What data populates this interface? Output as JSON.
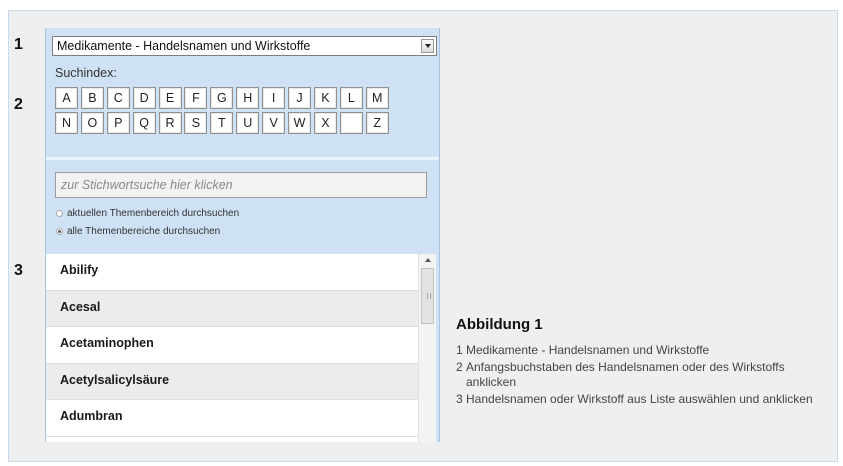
{
  "markers": [
    "1",
    "2",
    "3"
  ],
  "panel": {
    "dropdown": {
      "selected": "Medikamente - Handelsnamen und Wirkstoffe"
    },
    "suchindex_label": "Suchindex:",
    "letters_row1": [
      "A",
      "B",
      "C",
      "D",
      "E",
      "F",
      "G",
      "H",
      "I",
      "J",
      "K",
      "L",
      "M"
    ],
    "letters_row2": [
      "N",
      "O",
      "P",
      "Q",
      "R",
      "S",
      "T",
      "U",
      "V",
      "W",
      "X",
      "",
      "Z"
    ],
    "search": {
      "placeholder": "zur Stichwortsuche hier klicken"
    },
    "radio_options": [
      {
        "label": "aktuellen Themenbereich durchsuchen",
        "checked": false
      },
      {
        "label": "alle Themenbereiche durchsuchen",
        "checked": true
      }
    ],
    "list_items": [
      "Abilify",
      "Acesal",
      "Acetaminophen",
      "Acetylsalicylsäure",
      "Adumbran"
    ]
  },
  "caption": {
    "title": "Abbildung 1",
    "items": [
      {
        "n": "1",
        "text": "Medikamente - Handelsnamen und Wirkstoffe"
      },
      {
        "n": "2",
        "text": "Anfangsbuchstaben des Handelsnamen oder  des Wirkstoffs anklicken"
      },
      {
        "n": "3",
        "text": "Handelsnamen oder Wirkstoff aus Liste auswählen und anklicken"
      }
    ]
  },
  "colors": {
    "panel_bg": "#cfe2f5",
    "frame_bg": "#efefef"
  }
}
